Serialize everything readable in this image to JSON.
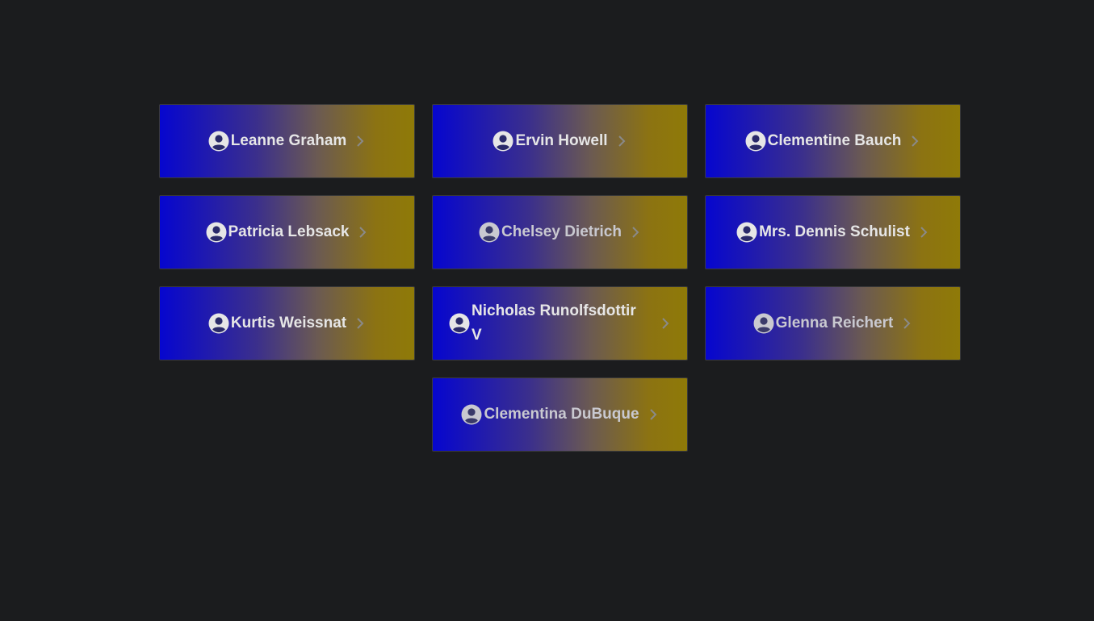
{
  "users": [
    {
      "name": "Leanne Graham"
    },
    {
      "name": "Ervin Howell"
    },
    {
      "name": "Clementine Bauch"
    },
    {
      "name": "Patricia Lebsack"
    },
    {
      "name": "Chelsey Dietrich"
    },
    {
      "name": "Mrs. Dennis Schulist"
    },
    {
      "name": "Kurtis Weissnat"
    },
    {
      "name": "Nicholas Runolfsdottir V"
    },
    {
      "name": "Glenna Reichert"
    },
    {
      "name": "Clementina DuBuque"
    }
  ],
  "icons": {
    "avatar": "user-circle-icon",
    "chevron": "chevron-right-icon"
  },
  "colors": {
    "background": "#1b1c1e",
    "gradient_start": "#0606cf",
    "gradient_end": "#8f7a08",
    "text": "#e6e6e6",
    "chevron": "#8a8a8a"
  }
}
